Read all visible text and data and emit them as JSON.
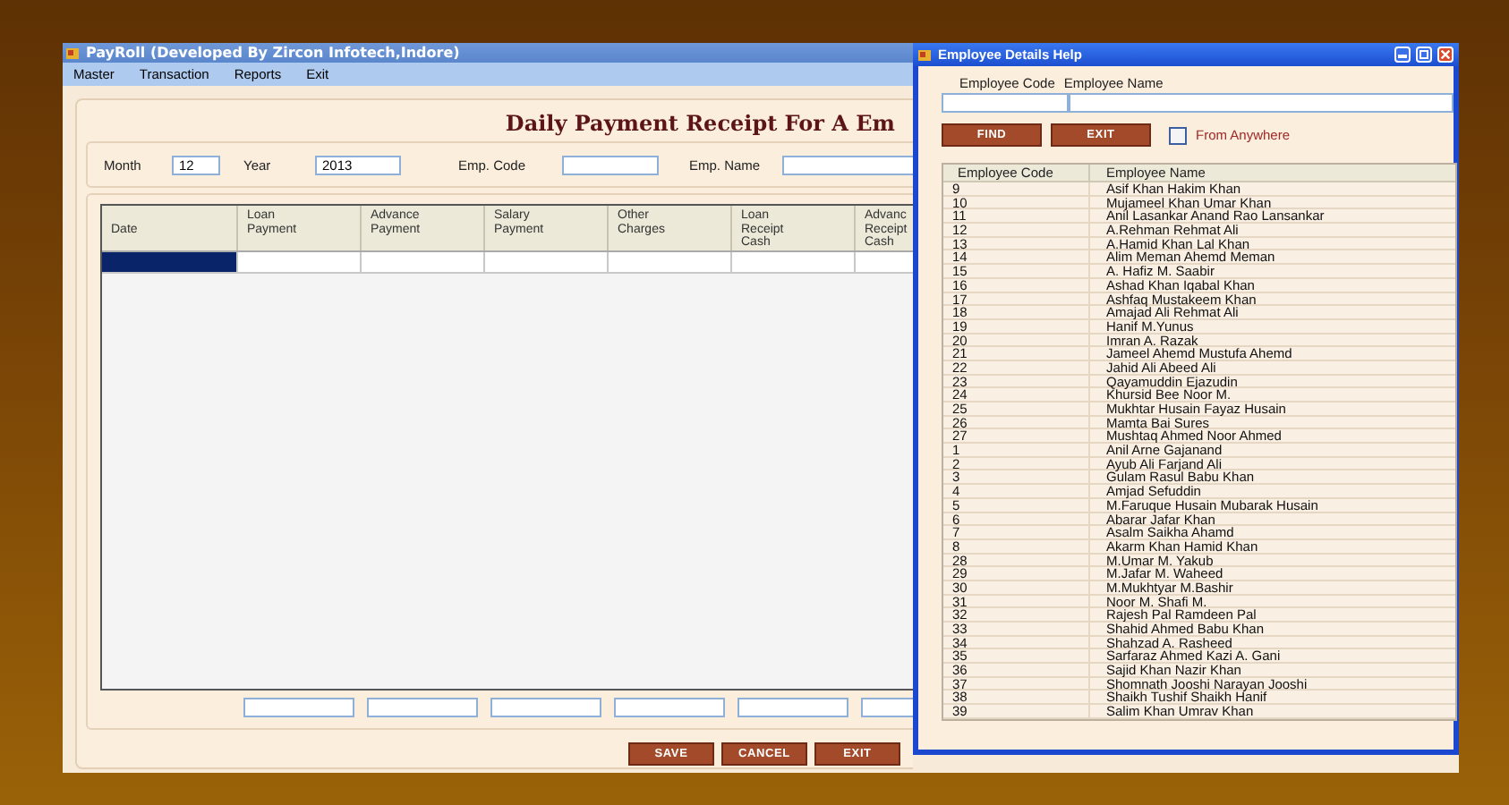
{
  "main_window": {
    "title": "PayRoll (Developed By Zircon Infotech,Indore)",
    "menu": [
      "Master",
      "Transaction",
      "Reports",
      "Exit"
    ],
    "form_title": "Daily Payment Receipt For A Em",
    "filters": [
      {
        "label": "Month",
        "value": "12"
      },
      {
        "label": "Year",
        "value": "2013"
      },
      {
        "label": "Emp. Code"
      },
      {
        "label": "Emp. Name"
      }
    ],
    "grid": {
      "columns": [
        {
          "label": "Date",
          "current": true
        },
        {
          "label": "Loan\nPayment",
          "current": false
        },
        {
          "label": "Advance\nPayment",
          "current": false
        },
        {
          "label": "Salary\nPayment",
          "current": false
        },
        {
          "label": "Other\nCharges",
          "current": false
        },
        {
          "label": "Loan\nReceipt\nCash",
          "current": false
        },
        {
          "label": "Advanc\nReceipt\nCash",
          "current": false
        }
      ]
    },
    "buttons": [
      "SAVE",
      "CANCEL",
      "EXIT"
    ]
  },
  "help_window": {
    "title": "Employee Details Help",
    "search_labels": [
      "Employee Code",
      "Employee Name"
    ],
    "buttons": [
      "FIND",
      "EXIT"
    ],
    "from_anywhere": {
      "label": "From Anywhere",
      "checked": false
    },
    "list": {
      "columns": [
        "Employee Code",
        "Employee Name"
      ],
      "rows": [
        [
          "9",
          "Asif Khan Hakim Khan"
        ],
        [
          "10",
          "Mujameel Khan Umar Khan"
        ],
        [
          "11",
          "Anil Lasankar Anand Rao Lansankar"
        ],
        [
          "12",
          "A.Rehman Rehmat Ali"
        ],
        [
          "13",
          "A.Hamid Khan Lal Khan"
        ],
        [
          "14",
          "Alim Meman Ahemd Meman"
        ],
        [
          "15",
          "A. Hafiz M. Saabir"
        ],
        [
          "16",
          "Ashad Khan Iqabal Khan"
        ],
        [
          "17",
          "Ashfaq Mustakeem Khan"
        ],
        [
          "18",
          "Amajad Ali Rehmat Ali"
        ],
        [
          "19",
          "Hanif M.Yunus"
        ],
        [
          "20",
          "Imran A. Razak"
        ],
        [
          "21",
          "Jameel Ahemd Mustufa Ahemd"
        ],
        [
          "22",
          "Jahid Ali Abeed Ali"
        ],
        [
          "23",
          "Qayamuddin Ejazudin"
        ],
        [
          "24",
          "Khursid Bee Noor M."
        ],
        [
          "25",
          "Mukhtar Husain Fayaz Husain"
        ],
        [
          "26",
          "Mamta Bai Sures"
        ],
        [
          "27",
          "Mushtaq Ahmed Noor Ahmed"
        ],
        [
          "1",
          "Anil Arne Gajanand"
        ],
        [
          "2",
          "Ayub Ali Farjand Ali"
        ],
        [
          "3",
          "Gulam Rasul Babu Khan"
        ],
        [
          "4",
          "Amjad Sefuddin"
        ],
        [
          "5",
          "M.Faruque Husain Mubarak Husain"
        ],
        [
          "6",
          "Abarar Jafar Khan"
        ],
        [
          "7",
          "Asalm Saikha Ahamd"
        ],
        [
          "8",
          "Akarm Khan Hamid Khan"
        ],
        [
          "28",
          "M.Umar M. Yakub"
        ],
        [
          "29",
          "M.Jafar M. Waheed"
        ],
        [
          "30",
          "M.Mukhtyar M.Bashir"
        ],
        [
          "31",
          "Noor M. Shafi M."
        ],
        [
          "32",
          "Rajesh Pal Ramdeen Pal"
        ],
        [
          "33",
          "Shahid Ahmed Babu Khan"
        ],
        [
          "34",
          "Shahzad A. Rasheed"
        ],
        [
          "35",
          "Sarfaraz Ahmed Kazi A. Gani"
        ],
        [
          "36",
          "Sajid Khan Nazir Khan"
        ],
        [
          "37",
          "Shomnath Jooshi Narayan Jooshi"
        ],
        [
          "38",
          "Shaikh Tushif Shaikh Hanif"
        ],
        [
          "39",
          "Salim Khan Umrav Khan"
        ]
      ]
    }
  }
}
